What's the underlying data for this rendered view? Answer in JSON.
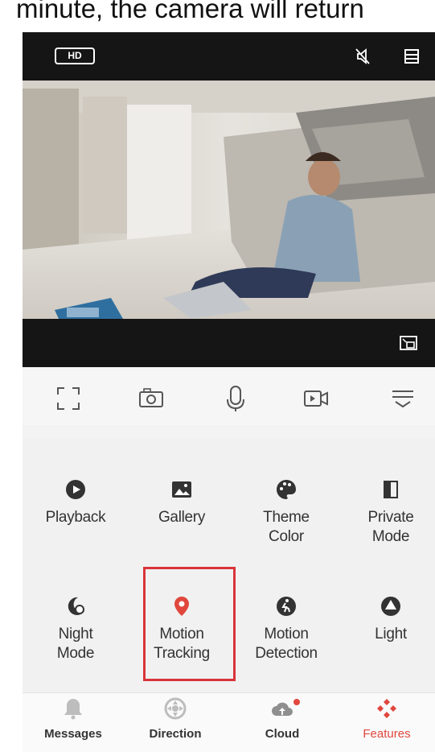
{
  "caption": "minute, the camera will return",
  "topbar": {
    "quality_badge": "HD",
    "icons": [
      "mute-icon",
      "menu-icon"
    ]
  },
  "video": {
    "icons": [
      "picture-in-picture-icon"
    ]
  },
  "controls": {
    "items": [
      "fullscreen-icon",
      "screenshot-icon",
      "microphone-icon",
      "record-video-icon",
      "more-icon"
    ]
  },
  "features": {
    "items": [
      {
        "label": "Playback",
        "icon": "play-icon"
      },
      {
        "label": "Gallery",
        "icon": "image-icon"
      },
      {
        "label": "Theme\nColor",
        "icon": "palette-icon"
      },
      {
        "label": "Private\nMode",
        "icon": "private-mode-icon"
      },
      {
        "label": "Night\nMode",
        "icon": "night-mode-icon"
      },
      {
        "label": "Motion\nTracking",
        "icon": "location-pin-icon"
      },
      {
        "label": "Motion\nDetection",
        "icon": "motion-detection-icon"
      },
      {
        "label": "Light",
        "icon": "light-icon"
      }
    ],
    "highlighted": "Motion\nTracking"
  },
  "bottom_nav": {
    "items": [
      {
        "label": "Messages",
        "icon": "bell-icon"
      },
      {
        "label": "Direction",
        "icon": "direction-icon"
      },
      {
        "label": "Cloud",
        "icon": "cloud-icon",
        "badge": true
      },
      {
        "label": "Features",
        "icon": "features-icon",
        "active": true
      }
    ]
  },
  "colors": {
    "accent": "#e0473d",
    "highlight_border": "#d9343a",
    "dark_bar": "#151515"
  }
}
